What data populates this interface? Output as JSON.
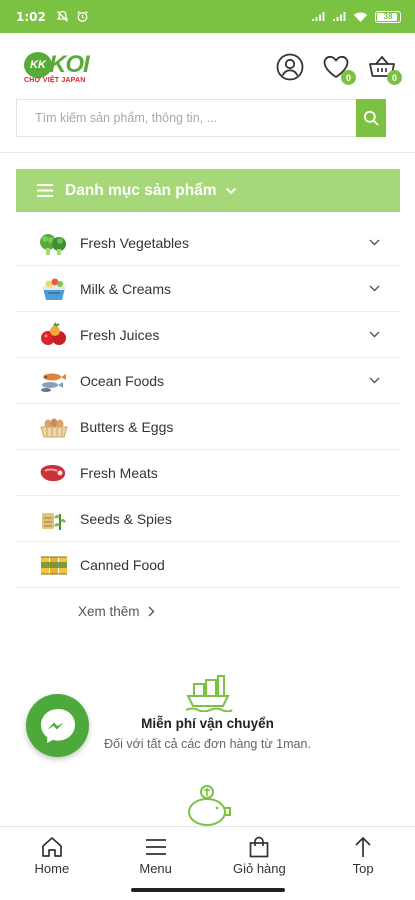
{
  "status_bar": {
    "time": "1:02",
    "battery": "38",
    "icons": [
      "mute-icon",
      "alarm-icon",
      "signal-icon",
      "signal-icon",
      "wifi-icon",
      "battery-icon"
    ]
  },
  "brand": {
    "logo_badge": "KK",
    "logo_text": "KOI",
    "logo_sub": "CHỢ VIỆT JAPAN",
    "primary_color": "#7cc242",
    "accent_red": "#d9232d"
  },
  "header": {
    "wishlist_count": "0",
    "cart_count": "0"
  },
  "search": {
    "placeholder": "Tìm kiếm sản phẩm, thông tin, ..."
  },
  "categories": {
    "title": "Danh mục sản phẩm",
    "items": [
      {
        "label": "Fresh Vegetables",
        "icon": "vegetables-icon",
        "has_children": true
      },
      {
        "label": "Milk & Creams",
        "icon": "milk-icon",
        "has_children": true
      },
      {
        "label": "Fresh Juices",
        "icon": "juice-icon",
        "has_children": true
      },
      {
        "label": "Ocean Foods",
        "icon": "seafood-icon",
        "has_children": true
      },
      {
        "label": "Butters & Eggs",
        "icon": "eggs-icon",
        "has_children": false
      },
      {
        "label": "Fresh Meats",
        "icon": "meat-icon",
        "has_children": false
      },
      {
        "label": "Seeds & Spies",
        "icon": "seeds-icon",
        "has_children": false
      },
      {
        "label": "Canned Food",
        "icon": "canned-icon",
        "has_children": false
      }
    ],
    "more_label": "Xem thêm"
  },
  "features": [
    {
      "title": "Miễn phí vận chuyển",
      "desc": "Đối với tất cả các đơn hàng từ 1man.",
      "icon": "ship-icon"
    },
    {
      "title": "",
      "desc": "",
      "icon": "piggy-bank-icon"
    }
  ],
  "bottom_nav": {
    "home": "Home",
    "menu": "Menu",
    "cart": "Giỏ hàng",
    "top": "Top"
  }
}
